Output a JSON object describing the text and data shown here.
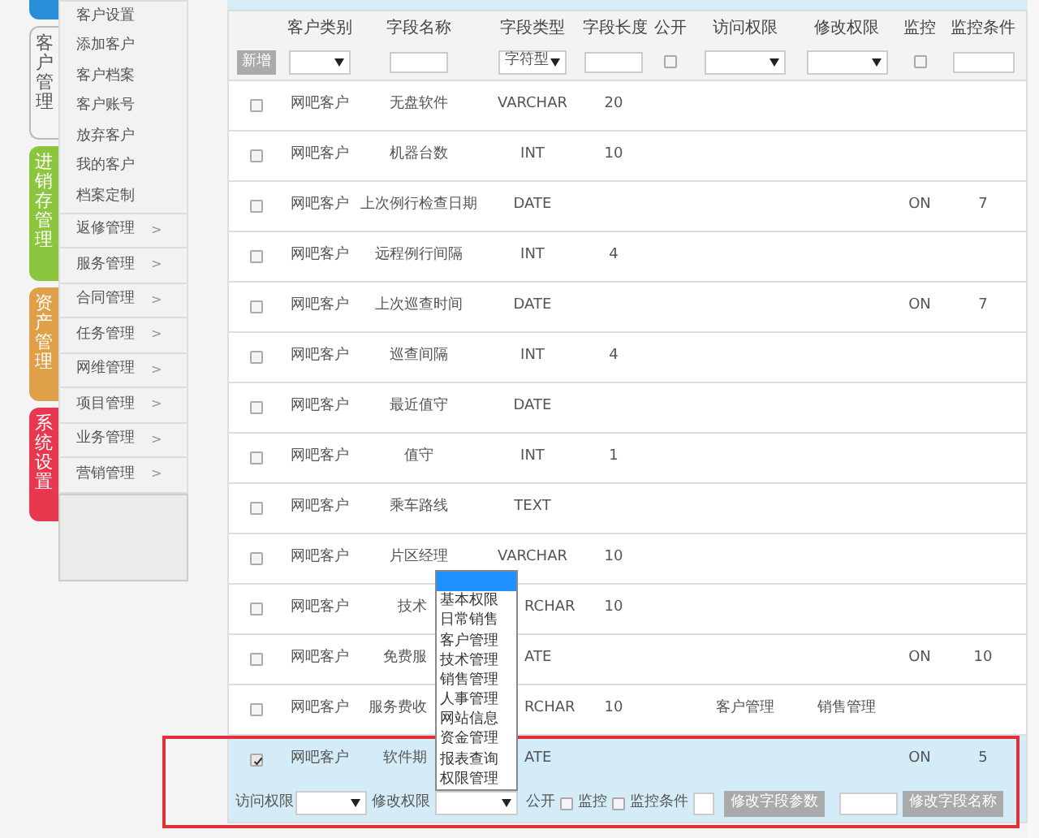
{
  "side_tabs": [
    {
      "color": "#2a8fd8",
      "selected": false
    },
    {
      "label": "客户管理",
      "color": "#f4f4f4",
      "selected": true
    },
    {
      "label": "进销存管理",
      "color": "#8cc63f",
      "selected": false
    },
    {
      "label": "资产管理",
      "color": "#e0a04a",
      "selected": false
    },
    {
      "label": "系统设置",
      "color": "#e8384f",
      "selected": false
    }
  ],
  "menu": [
    {
      "label": "客户设置",
      "has_submenu": false
    },
    {
      "label": "添加客户",
      "has_submenu": false
    },
    {
      "label": "客户档案",
      "has_submenu": false
    },
    {
      "label": "客户账号",
      "has_submenu": false
    },
    {
      "label": "放弃客户",
      "has_submenu": false
    },
    {
      "label": "我的客户",
      "has_submenu": false
    },
    {
      "label": "档案定制",
      "has_submenu": false
    },
    {
      "label": "返修管理",
      "has_submenu": true,
      "arrow": ">"
    },
    {
      "label": "服务管理",
      "has_submenu": true,
      "arrow": ">"
    },
    {
      "label": "合同管理",
      "has_submenu": true,
      "arrow": ">"
    },
    {
      "label": "任务管理",
      "has_submenu": true,
      "arrow": ">"
    },
    {
      "label": "网维管理",
      "has_submenu": true,
      "arrow": ">"
    },
    {
      "label": "项目管理",
      "has_submenu": true,
      "arrow": ">"
    },
    {
      "label": "业务管理",
      "has_submenu": true,
      "arrow": ">"
    },
    {
      "label": "营销管理",
      "has_submenu": true,
      "arrow": ">"
    }
  ],
  "table": {
    "columns": [
      "客户类别",
      "字段名称",
      "字段类型",
      "字段长度",
      "公开",
      "访问权限",
      "修改权限",
      "监控",
      "监控条件"
    ],
    "filter": {
      "add_button": "新增",
      "type_select": "字符型",
      "public_checked": false,
      "monitor_checked": false
    },
    "rows": [
      {
        "checked": false,
        "category": "网吧客户",
        "name": "无盘软件",
        "type": "VARCHAR",
        "length": "20",
        "covered": false
      },
      {
        "checked": false,
        "category": "网吧客户",
        "name": "机器台数",
        "type": "INT",
        "length": "10",
        "covered": false
      },
      {
        "checked": false,
        "category": "网吧客户",
        "name": "上次例行检查日期",
        "type": "DATE",
        "monitor": "ON",
        "condition": "7",
        "covered": false
      },
      {
        "checked": false,
        "category": "网吧客户",
        "name": "远程例行间隔",
        "type": "INT",
        "length": "4",
        "covered": false
      },
      {
        "checked": false,
        "category": "网吧客户",
        "name": "上次巡查时间",
        "type": "DATE",
        "monitor": "ON",
        "condition": "7",
        "covered": false
      },
      {
        "checked": false,
        "category": "网吧客户",
        "name": "巡查间隔",
        "type": "INT",
        "length": "4",
        "covered": false
      },
      {
        "checked": false,
        "category": "网吧客户",
        "name": "最近值守",
        "type": "DATE",
        "covered": false
      },
      {
        "checked": false,
        "category": "网吧客户",
        "name": "值守",
        "type": "INT",
        "length": "1",
        "covered": false
      },
      {
        "checked": false,
        "category": "网吧客户",
        "name": "乘车路线",
        "type": "TEXT",
        "covered": false
      },
      {
        "checked": false,
        "category": "网吧客户",
        "name": "片区经理",
        "type": "VARCHAR",
        "length": "10",
        "covered": false
      },
      {
        "checked": false,
        "category": "网吧客户",
        "name": "技术",
        "type": "RCHAR",
        "length": "10",
        "covered": true
      },
      {
        "checked": false,
        "category": "网吧客户",
        "name": "免费服",
        "type": "ATE",
        "monitor": "ON",
        "condition": "10",
        "covered": true
      },
      {
        "checked": false,
        "category": "网吧客户",
        "name": "服务费收",
        "type": "RCHAR",
        "length": "10",
        "access": "客户管理",
        "modify": "销售管理",
        "covered": true
      },
      {
        "checked": true,
        "selected": true,
        "category": "网吧客户",
        "name": "软件期",
        "type": "ATE",
        "monitor": "ON",
        "condition": "5",
        "covered": true
      }
    ]
  },
  "edit_bar": {
    "access_label": "访问权限",
    "modify_label": "修改权限",
    "public_label": "公开",
    "public_checked": false,
    "monitor_label": "监控",
    "monitor_checked": false,
    "condition_label": "监控条件",
    "params_button": "修改字段参数",
    "rename_button": "修改字段名称",
    "modify_options": [
      {
        "selected": true
      },
      {
        "label": "基本权限",
        "selected": false
      },
      {
        "label": "日常销售",
        "selected": false
      },
      {
        "label": "客户管理",
        "selected": false
      },
      {
        "label": "技术管理",
        "selected": false
      },
      {
        "label": "销售管理",
        "selected": false
      },
      {
        "label": "人事管理",
        "selected": false
      },
      {
        "label": "网站信息",
        "selected": false
      },
      {
        "label": "资金管理",
        "selected": false
      },
      {
        "label": "报表查询",
        "selected": false
      },
      {
        "label": "权限管理",
        "selected": false
      }
    ]
  }
}
